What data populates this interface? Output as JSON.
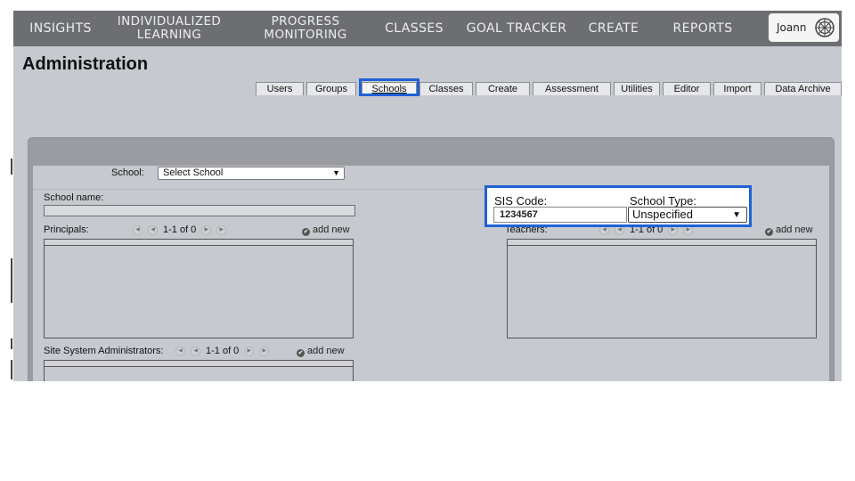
{
  "topnav": {
    "items": [
      {
        "label": "INSIGHTS"
      },
      {
        "label": "INDIVIDUALIZED\nLEARNING"
      },
      {
        "label": "PROGRESS\nMONITORING"
      },
      {
        "label": "CLASSES"
      },
      {
        "label": "GOAL TRACKER"
      },
      {
        "label": "CREATE"
      },
      {
        "label": "REPORTS"
      }
    ],
    "user_name": "Joann"
  },
  "page": {
    "title": "Administration"
  },
  "subtabs": [
    "Users",
    "Groups",
    "Schools",
    "Classes",
    "Create",
    "Assessment",
    "Utilities",
    "Editor",
    "Import",
    "Data Archive"
  ],
  "active_subtab": "Schools",
  "school_form": {
    "school_label": "School:",
    "school_select_value": "Select School",
    "school_name_label": "School name:",
    "sis_code_label": "SIS Code:",
    "sis_code_value": "1234567",
    "school_type_label": "School Type:",
    "school_type_value": "Unspecified",
    "principals_label": "Principals:",
    "teachers_label": "Teachers:",
    "site_admins_label": "Site System Administrators:",
    "pager_text": "1-1 of 0",
    "add_new_label": "add new"
  },
  "colors": {
    "highlight": "#1f62d6",
    "nav_bg": "#6d6e72",
    "app_bg": "#c6c9cf"
  }
}
